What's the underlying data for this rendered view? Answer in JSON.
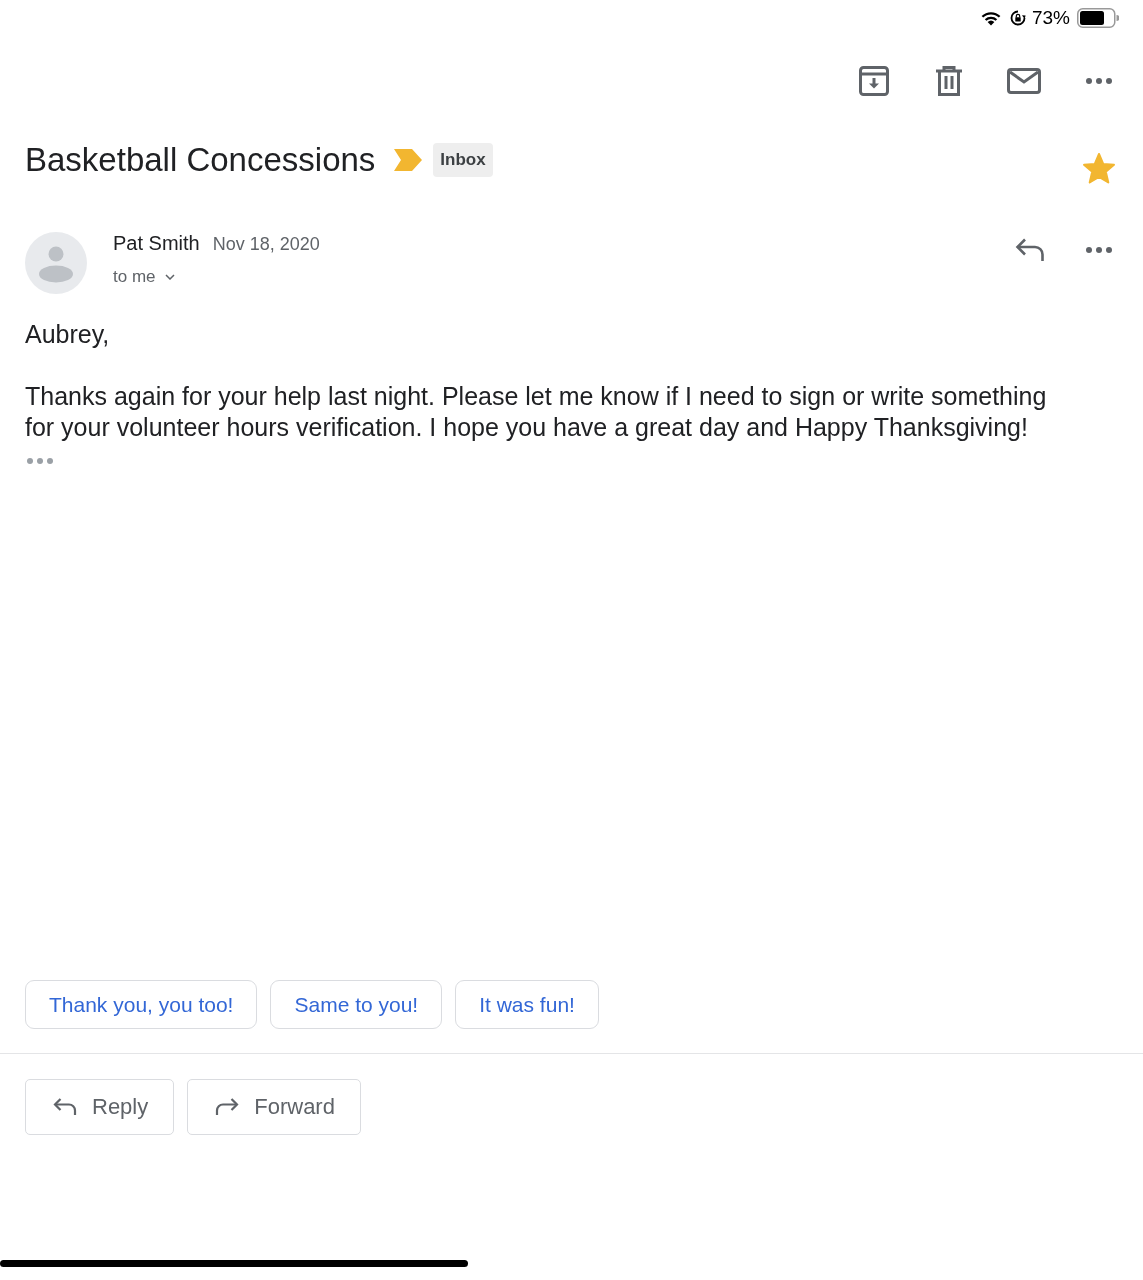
{
  "status_bar": {
    "battery_percent": "73%"
  },
  "subject": {
    "title": "Basketball Concessions",
    "important": true,
    "label": "Inbox",
    "starred": true
  },
  "message": {
    "sender": "Pat Smith",
    "date": "Nov 18, 2020",
    "recipient": "to me",
    "greeting": "Aubrey,",
    "body": "Thanks again for your help last night. Please let me know if I need to sign or write something for your volunteer hours verification. I hope you have a great day and Happy Thanksgiving!"
  },
  "smart_replies": [
    "Thank you, you too!",
    "Same to you!",
    "It was fun!"
  ],
  "actions": [
    {
      "kind": "reply",
      "label": "Reply"
    },
    {
      "kind": "forward",
      "label": "Forward"
    }
  ]
}
